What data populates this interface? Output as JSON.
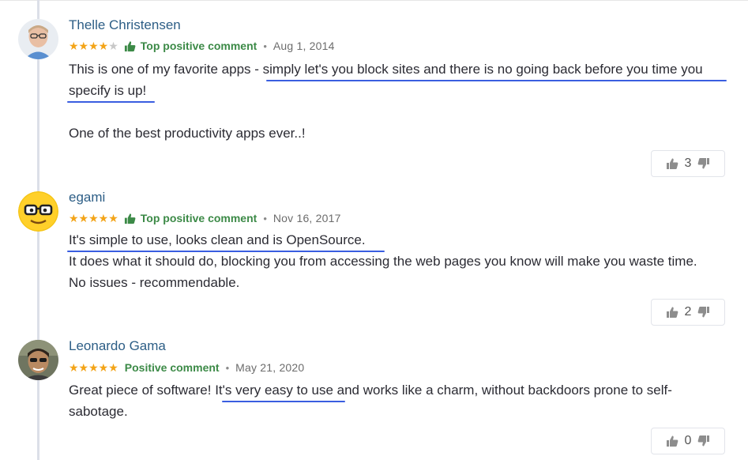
{
  "reviews": [
    {
      "author": "Thelle Christensen",
      "rating": 4,
      "stars_text": "★★★★",
      "stars_off": "★",
      "badge": "Top positive comment",
      "date": "Aug 1, 2014",
      "line1_a": "This is one of my favorite apps - ",
      "line1_b": "simply let's you block sites and there is no going back before you time you",
      "line2": "specify is up!",
      "line3": "One of the best productivity apps ever..!",
      "votes": "3"
    },
    {
      "author": "egami",
      "rating": 5,
      "stars_text": "★★★★★",
      "badge": "Top positive comment",
      "date": "Nov 16, 2017",
      "line1": "It's simple to use, looks clean and is OpenSource.",
      "line2": "It does what it should do, blocking you from accessing the web pages you know will make you waste time.",
      "line3": "No issues - recommendable.",
      "votes": "2"
    },
    {
      "author": "Leonardo Gama",
      "rating": 5,
      "stars_text": "★★★★★",
      "badge": "Positive comment",
      "date": "May 21, 2020",
      "line1_a": "Great piece of software! ",
      "line1_b": "It's very easy to use",
      "line1_c": " and works like a charm, without backdoors prone to self-",
      "line2": "sabotage.",
      "votes": "0"
    }
  ],
  "separator": "•",
  "colors": {
    "star": "#f3a418",
    "badge": "#3c8a47",
    "author": "#2d5e86",
    "underline": "#3a5ee0",
    "timeline": "#dcdfe8"
  },
  "icons": [
    "thumbs-up-icon",
    "thumbs-down-icon",
    "avatar"
  ]
}
